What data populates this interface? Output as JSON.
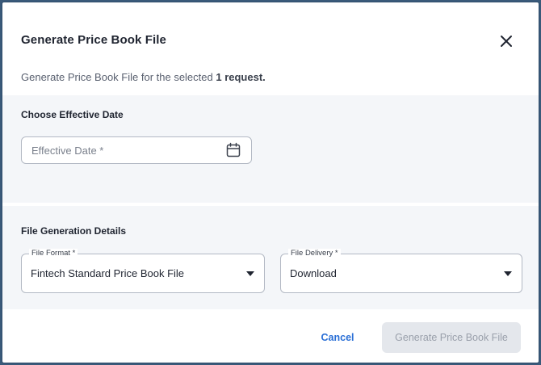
{
  "dialog": {
    "title": "Generate Price Book File",
    "subtitle_prefix": "Generate Price Book File for the selected ",
    "subtitle_count": "1 request."
  },
  "effective_date_section": {
    "label": "Choose Effective Date",
    "date_placeholder": "Effective Date *"
  },
  "file_generation_section": {
    "label": "File Generation Details",
    "file_format": {
      "legend": "File Format *",
      "value": "Fintech Standard Price Book File"
    },
    "file_delivery": {
      "legend": "File Delivery *",
      "value": "Download"
    }
  },
  "footer": {
    "cancel_label": "Cancel",
    "generate_label": "Generate Price Book File"
  },
  "colors": {
    "accent": "#2a6fd6",
    "section_bg": "#f4f6f9",
    "disabled_bg": "#e4e7ec"
  }
}
